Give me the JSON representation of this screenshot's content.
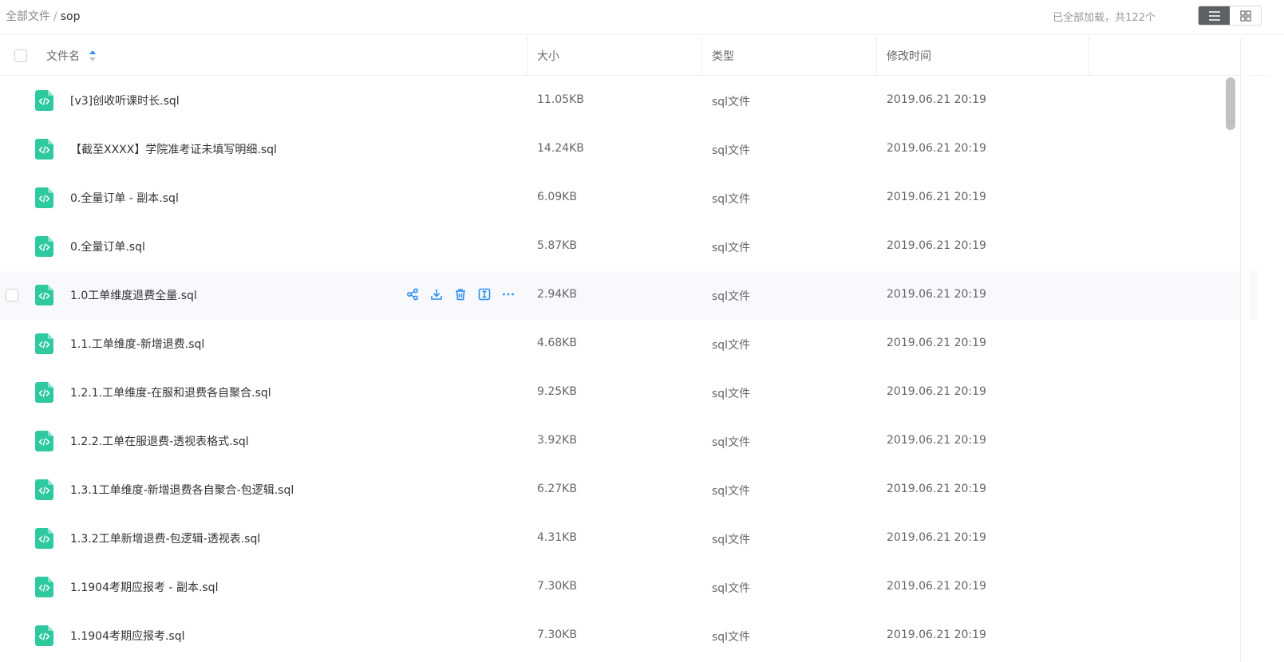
{
  "breadcrumb": {
    "root": "全部文件",
    "separator": "/",
    "current": "sop"
  },
  "status_text": "已全部加载，共122个",
  "view_toggle": {
    "list_icon": "list-icon",
    "grid_icon": "grid-icon",
    "active": "list"
  },
  "table": {
    "headers": {
      "name": "文件名",
      "size": "大小",
      "type": "类型",
      "modified": "修改时间"
    },
    "rows": [
      {
        "name": "[v3]创收听课时长.sql",
        "size": "11.05KB",
        "type": "sql文件",
        "modified": "2019.06.21 20:19"
      },
      {
        "name": "【截至XXXX】学院准考证未填写明细.sql",
        "size": "14.24KB",
        "type": "sql文件",
        "modified": "2019.06.21 20:19"
      },
      {
        "name": "0.全量订单 - 副本.sql",
        "size": "6.09KB",
        "type": "sql文件",
        "modified": "2019.06.21 20:19"
      },
      {
        "name": "0.全量订单.sql",
        "size": "5.87KB",
        "type": "sql文件",
        "modified": "2019.06.21 20:19"
      },
      {
        "name": "1.0工单维度退费全量.sql",
        "size": "2.94KB",
        "type": "sql文件",
        "modified": "2019.06.21 20:19"
      },
      {
        "name": "1.1.工单维度-新增退费.sql",
        "size": "4.68KB",
        "type": "sql文件",
        "modified": "2019.06.21 20:19"
      },
      {
        "name": "1.2.1.工单维度-在服和退费各自聚合.sql",
        "size": "9.25KB",
        "type": "sql文件",
        "modified": "2019.06.21 20:19"
      },
      {
        "name": "1.2.2.工单在服退费-透视表格式.sql",
        "size": "3.92KB",
        "type": "sql文件",
        "modified": "2019.06.21 20:19"
      },
      {
        "name": "1.3.1工单维度-新增退费各自聚合-包逻辑.sql",
        "size": "6.27KB",
        "type": "sql文件",
        "modified": "2019.06.21 20:19"
      },
      {
        "name": "1.3.2工单新增退费-包逻辑-透视表.sql",
        "size": "4.31KB",
        "type": "sql文件",
        "modified": "2019.06.21 20:19"
      },
      {
        "name": "1.1904考期应报考 - 副本.sql",
        "size": "7.30KB",
        "type": "sql文件",
        "modified": "2019.06.21 20:19"
      },
      {
        "name": "1.1904考期应报考.sql",
        "size": "7.30KB",
        "type": "sql文件",
        "modified": "2019.06.21 20:19"
      }
    ]
  },
  "hover_row_index": 4,
  "row_actions": [
    "share-icon",
    "download-icon",
    "delete-icon",
    "rename-icon",
    "more-icon"
  ],
  "colors": {
    "accent": "#2e8ff0",
    "file_icon": "#2fc9a0",
    "hover_bg": "#f7f9fc"
  }
}
